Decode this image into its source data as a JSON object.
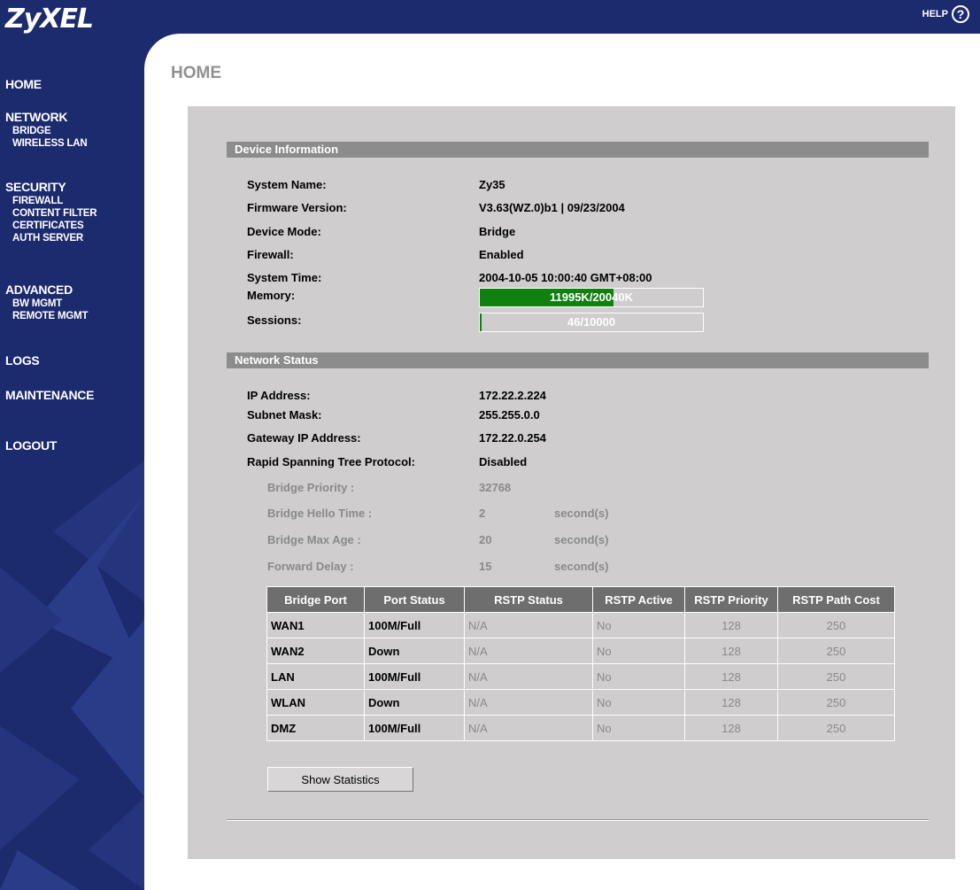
{
  "header": {
    "logo": "ZyXEL",
    "help_label": "HELP",
    "help_glyph": "?"
  },
  "sidebar": {
    "home": "HOME",
    "network": {
      "label": "NETWORK",
      "items": [
        "BRIDGE",
        "WIRELESS LAN"
      ]
    },
    "security": {
      "label": "SECURITY",
      "items": [
        "FIREWALL",
        "CONTENT FILTER",
        "CERTIFICATES",
        "AUTH SERVER"
      ]
    },
    "advanced": {
      "label": "ADVANCED",
      "items": [
        "BW MGMT",
        "REMOTE MGMT"
      ]
    },
    "logs": "LOGS",
    "maintenance": "MAINTENANCE",
    "logout": "LOGOUT"
  },
  "page": {
    "title": "HOME"
  },
  "device_info": {
    "section_title": "Device Information",
    "system_name_label": "System Name:",
    "system_name": "Zy35",
    "firmware_label": "Firmware Version:",
    "firmware": "V3.63(WZ.0)b1 | 09/23/2004",
    "mode_label": "Device Mode:",
    "mode": "Bridge",
    "firewall_label": "Firewall:",
    "firewall": "Enabled",
    "time_label": "System Time:",
    "time": "2004-10-05 10:00:40 GMT+08:00",
    "memory_label": "Memory:",
    "memory_text": "11995K/20040K",
    "memory_fraction": 0.6,
    "sessions_label": "Sessions:",
    "sessions_text": "46/10000",
    "sessions_fraction": 0.0046
  },
  "network_status": {
    "section_title": "Network Status",
    "ip_label": "IP Address:",
    "ip": "172.22.2.224",
    "mask_label": "Subnet Mask:",
    "mask": "255.255.0.0",
    "gw_label": "Gateway IP Address:",
    "gw": "172.22.0.254",
    "rstp_label": "Rapid Spanning Tree Protocol:",
    "rstp": "Disabled",
    "priority_label": "Bridge Priority :",
    "priority": "32768",
    "hello_label": "Bridge Hello Time :",
    "hello": "2",
    "hello_unit": "second(s)",
    "maxage_label": "Bridge Max Age :",
    "maxage": "20",
    "maxage_unit": "second(s)",
    "fwd_label": "Forward Delay :",
    "fwd": "15",
    "fwd_unit": "second(s)"
  },
  "ports_table": {
    "headers": [
      "Bridge Port",
      "Port Status",
      "RSTP Status",
      "RSTP Active",
      "RSTP Priority",
      "RSTP Path Cost"
    ],
    "rows": [
      [
        "WAN1",
        "100M/Full",
        "N/A",
        "No",
        "128",
        "250"
      ],
      [
        "WAN2",
        "Down",
        "N/A",
        "No",
        "128",
        "250"
      ],
      [
        "LAN",
        "100M/Full",
        "N/A",
        "No",
        "128",
        "250"
      ],
      [
        "WLAN",
        "Down",
        "N/A",
        "No",
        "128",
        "250"
      ],
      [
        "DMZ",
        "100M/Full",
        "N/A",
        "No",
        "128",
        "250"
      ]
    ]
  },
  "show_statistics_label": "Show Statistics"
}
